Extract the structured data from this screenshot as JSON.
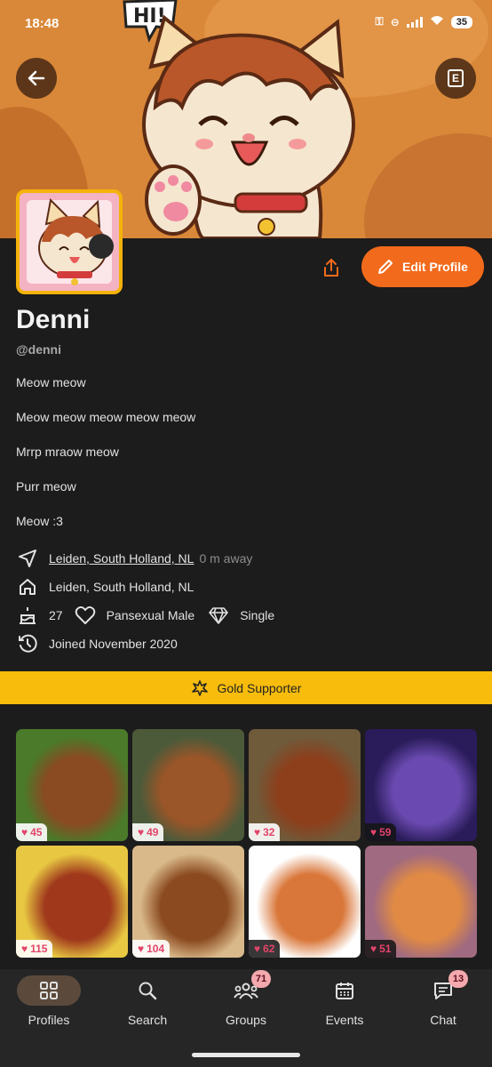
{
  "status": {
    "time": "18:48",
    "battery": "35"
  },
  "banner": {
    "speech": "HI!"
  },
  "header": {
    "edit_label": "Edit Profile",
    "e_label": "E"
  },
  "profile": {
    "name": "Denni",
    "handle": "@denni",
    "bio": [
      "Meow meow",
      "Meow meow meow meow meow",
      "Mrrp mraow meow",
      "Purr meow",
      "Meow :3"
    ],
    "location": "Leiden, South Holland, NL",
    "distance": "0 m away",
    "home": "Leiden, South Holland, NL",
    "age": "27",
    "orientation": "Pansexual Male",
    "relationship": "Single",
    "joined": "Joined November 2020"
  },
  "gold": {
    "label": "Gold Supporter"
  },
  "photos": [
    {
      "likes": "45",
      "colors": [
        "#4a7a2a",
        "#8a4a22"
      ]
    },
    {
      "likes": "49",
      "colors": [
        "#4c5a3a",
        "#9a5528"
      ]
    },
    {
      "likes": "32",
      "colors": [
        "#6f5a3a",
        "#8d3f1c"
      ]
    },
    {
      "likes": "59",
      "colors": [
        "#2a1c5a",
        "#6a4ab0"
      ]
    },
    {
      "likes": "115",
      "colors": [
        "#e8c842",
        "#a0391c"
      ]
    },
    {
      "likes": "104",
      "colors": [
        "#d9b98a",
        "#8b4a20"
      ]
    },
    {
      "likes": "62",
      "colors": [
        "#ffffff",
        "#d9773a"
      ]
    },
    {
      "likes": "51",
      "colors": [
        "#a06a80",
        "#e08a45"
      ]
    }
  ],
  "nav": {
    "items": [
      {
        "label": "Profiles",
        "badge": ""
      },
      {
        "label": "Search",
        "badge": ""
      },
      {
        "label": "Groups",
        "badge": "71"
      },
      {
        "label": "Events",
        "badge": ""
      },
      {
        "label": "Chat",
        "badge": "13"
      }
    ]
  },
  "colors": {
    "accent": "#f26a1b",
    "gold": "#f7bc0c",
    "background": "#1c1c1c",
    "heart": "#e2446a"
  }
}
